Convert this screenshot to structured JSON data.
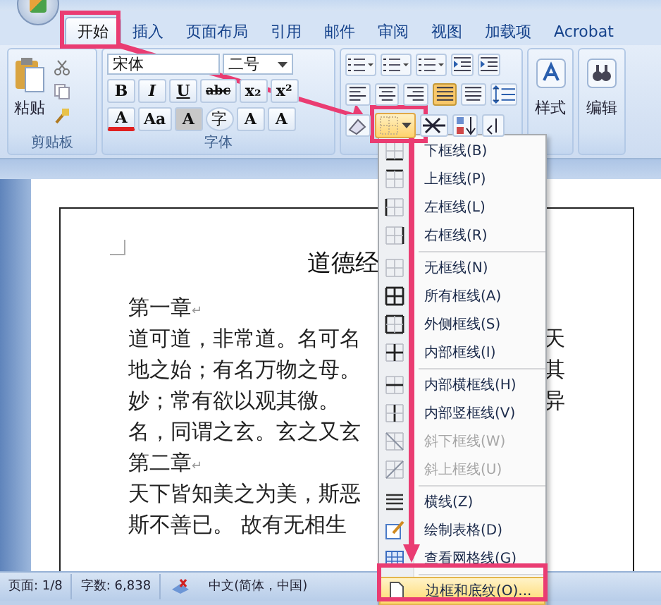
{
  "tabs": [
    {
      "label": "开始",
      "selected": true
    },
    {
      "label": "插入",
      "selected": false
    },
    {
      "label": "页面布局",
      "selected": false
    },
    {
      "label": "引用",
      "selected": false
    },
    {
      "label": "邮件",
      "selected": false
    },
    {
      "label": "审阅",
      "selected": false
    },
    {
      "label": "视图",
      "selected": false
    },
    {
      "label": "加载项",
      "selected": false
    },
    {
      "label": "Acrobat",
      "selected": false
    }
  ],
  "clipboard": {
    "paste": "粘贴",
    "label": "剪贴板"
  },
  "font": {
    "family": "宋体",
    "size": "二号",
    "label": "字体",
    "row2": [
      "B",
      "I",
      "U",
      "abc",
      "x₂",
      "x²"
    ],
    "row3": [
      "A",
      "Aa",
      "A",
      "字",
      "A",
      "A"
    ]
  },
  "paragraph": {
    "alignment": [
      {
        "kind": "left",
        "selected": false
      },
      {
        "kind": "center",
        "selected": false
      },
      {
        "kind": "right",
        "selected": false
      },
      {
        "kind": "justify",
        "selected": true
      },
      {
        "kind": "distributed",
        "selected": false
      }
    ]
  },
  "styles": {
    "label": "样式"
  },
  "editing": {
    "label": "编辑"
  },
  "borders_menu": {
    "items": [
      {
        "kind": "bottom",
        "label": "下框线(B)",
        "disabled": false,
        "selected": false
      },
      {
        "kind": "top",
        "label": "上框线(P)",
        "disabled": false,
        "selected": false
      },
      {
        "kind": "left",
        "label": "左框线(L)",
        "disabled": false,
        "selected": false
      },
      {
        "kind": "right",
        "label": "右框线(R)",
        "disabled": false,
        "selected": false
      },
      {
        "kind": "none",
        "label": "无框线(N)",
        "disabled": false,
        "selected": false
      },
      {
        "kind": "all",
        "label": "所有框线(A)",
        "disabled": false,
        "selected": false
      },
      {
        "kind": "outside",
        "label": "外侧框线(S)",
        "disabled": false,
        "selected": false
      },
      {
        "kind": "inside",
        "label": "内部框线(I)",
        "disabled": false,
        "selected": false
      },
      {
        "kind": "inside_h",
        "label": "内部横框线(H)",
        "disabled": false,
        "selected": false
      },
      {
        "kind": "inside_v",
        "label": "内部竖框线(V)",
        "disabled": false,
        "selected": false
      },
      {
        "kind": "diag_down",
        "label": "斜下框线(W)",
        "disabled": true,
        "selected": false
      },
      {
        "kind": "diag_up",
        "label": "斜上框线(U)",
        "disabled": true,
        "selected": false
      },
      {
        "kind": "hline",
        "label": "横线(Z)",
        "disabled": false,
        "selected": false
      },
      {
        "kind": "draw",
        "label": "绘制表格(D)",
        "disabled": false,
        "selected": false
      },
      {
        "kind": "grid",
        "label": "查看网格线(G)",
        "disabled": false,
        "selected": false
      },
      {
        "kind": "dialog",
        "label": "边框和底纹(O)...",
        "disabled": false,
        "selected": true
      }
    ]
  },
  "document": {
    "title": "道德经",
    "lines": [
      {
        "text": "第一章",
        "mark": "↵"
      },
      {
        "text": "道可道，非常道。名可名",
        "right": "天"
      },
      {
        "text": "地之始；有名万物之母。",
        "right": "其"
      },
      {
        "text": "妙；常有欲以观其徼。",
        "right": "异"
      },
      {
        "text": "名，同谓之玄。玄之又玄"
      },
      {
        "text": "第二章",
        "mark": "↵"
      },
      {
        "text": "天下皆知美之为美，斯恶"
      },
      {
        "text": "斯不善已。 故有无相生"
      }
    ]
  },
  "status_bar": {
    "page": "页面: 1/8",
    "words": "字数: 6,838",
    "language": "中文(简体，中国)"
  }
}
